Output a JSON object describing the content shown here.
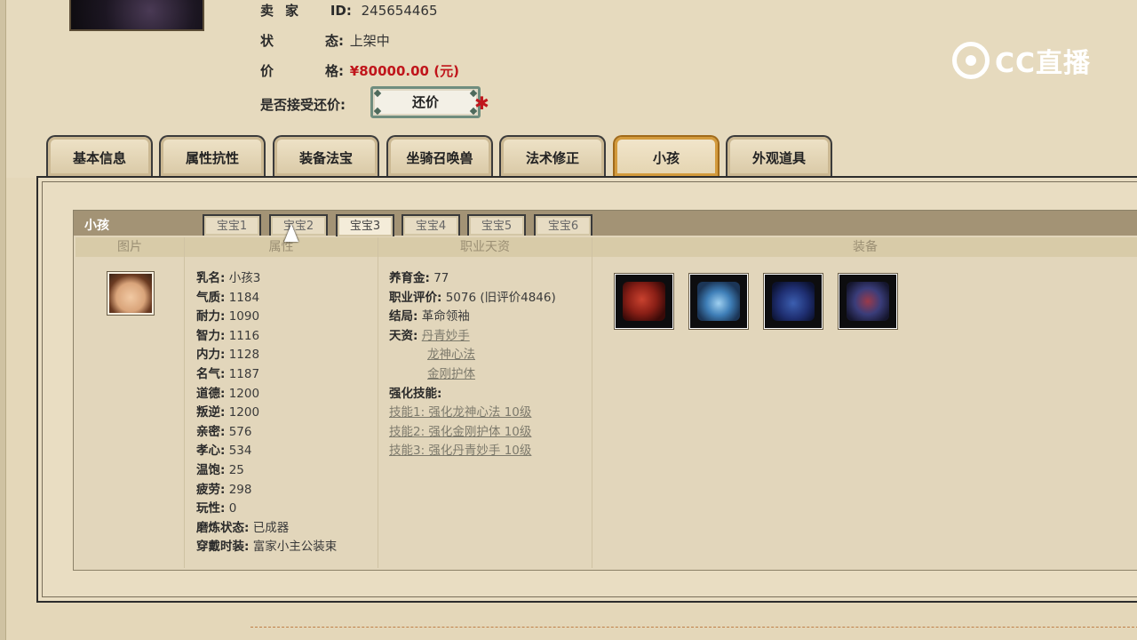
{
  "seller": {
    "label_a": "卖",
    "label_b": "家",
    "id_label": "ID:",
    "id_value": "245654465"
  },
  "status": {
    "label_a": "状",
    "label_b": "态:",
    "value": "上架中"
  },
  "price": {
    "label_a": "价",
    "label_b": "格:",
    "value": "¥80000.00 (元)"
  },
  "counter_offer": {
    "label": "是否接受还价:",
    "button": "还价",
    "mark": "✱"
  },
  "watermark": {
    "text": "CC直播"
  },
  "main_tabs": [
    "基本信息",
    "属性抗性",
    "装备法宝",
    "坐骑召唤兽",
    "法术修正",
    "小孩",
    "外观道具"
  ],
  "main_tab_active": "小孩",
  "kid_panel": {
    "title": "小孩",
    "sub_tabs": [
      "宝宝1",
      "宝宝2",
      "宝宝3",
      "宝宝4",
      "宝宝5",
      "宝宝6"
    ],
    "sub_tab_active": "宝宝3",
    "columns": [
      "图片",
      "属性",
      "职业天资",
      "装备"
    ],
    "attributes": [
      {
        "label": "乳名:",
        "value": "小孩3"
      },
      {
        "label": "气质:",
        "value": "1184"
      },
      {
        "label": "耐力:",
        "value": "1090"
      },
      {
        "label": "智力:",
        "value": "1116"
      },
      {
        "label": "内力:",
        "value": "1128"
      },
      {
        "label": "名气:",
        "value": "1187"
      },
      {
        "label": "道德:",
        "value": "1200"
      },
      {
        "label": "叛逆:",
        "value": "1200"
      },
      {
        "label": "亲密:",
        "value": "576"
      },
      {
        "label": "孝心:",
        "value": "534"
      },
      {
        "label": "温饱:",
        "value": "25"
      },
      {
        "label": "疲劳:",
        "value": "298"
      },
      {
        "label": "玩性:",
        "value": "0"
      },
      {
        "label": "磨炼状态:",
        "value": "已成器"
      },
      {
        "label": "穿戴时装:",
        "value": "富家小主公装束"
      }
    ],
    "career": {
      "fund_label": "养育金:",
      "fund_value": "77",
      "rating_label": "职业评价:",
      "rating_value": "5076 (旧评价4846)",
      "ending_label": "结局:",
      "ending_value": "革命领袖",
      "talent_label": "天资:",
      "talents": [
        "丹青妙手",
        "龙神心法",
        "金刚护体"
      ],
      "skill_header": "强化技能:",
      "skills": [
        "技能1: 强化龙神心法 10级",
        "技能2: 强化金刚护体 10级",
        "技能3: 强化丹青妙手 10级"
      ]
    },
    "equipment": [
      "equip-red-armor-icon",
      "equip-blue-robe-icon",
      "equip-blue-book-icon",
      "equip-chest-icon"
    ]
  },
  "colors": {
    "accent_red": "#c0151b",
    "tab_active_border": "#a06a1a",
    "button_border": "#6f8d7e"
  }
}
